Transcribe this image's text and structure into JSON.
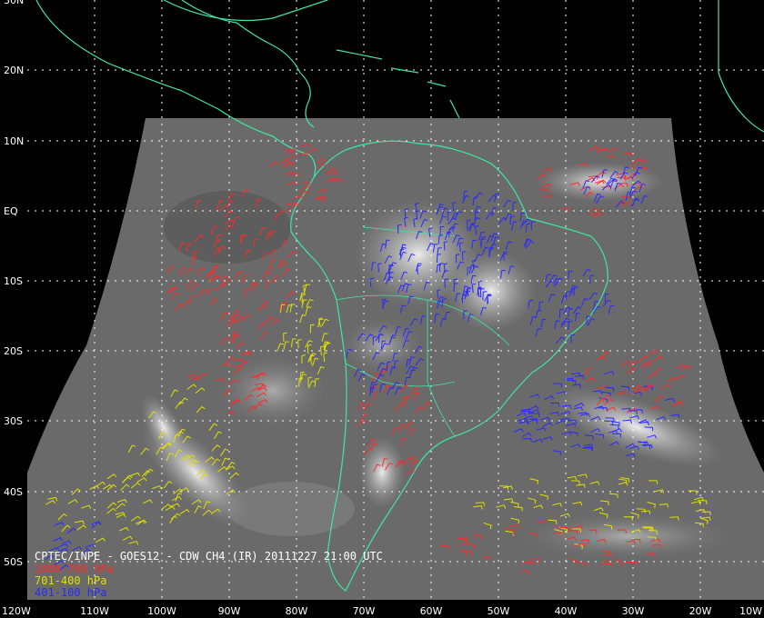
{
  "product_title": "CPTEC/INPE - GOES12 - CDW CH4 (IR) 20111227 21:00 UTC",
  "legend": [
    {
      "label": "1000-700 hPa",
      "color": "#ff2a2a"
    },
    {
      "label": "701-400 hPa",
      "color": "#e0e000"
    },
    {
      "label": "401-100 hPa",
      "color": "#2a2aff"
    }
  ],
  "lat_labels": [
    "30N",
    "20N",
    "10N",
    "EQ",
    "10S",
    "20S",
    "30S",
    "40S",
    "50S"
  ],
  "lon_labels": [
    "120W",
    "110W",
    "100W",
    "90W",
    "80W",
    "70W",
    "60W",
    "50W",
    "40W",
    "30W",
    "20W",
    "10W"
  ],
  "colors": {
    "coastline": "#3ee6a8",
    "grid": "#ffffff",
    "background": "#000000",
    "imagery": "#6e6e6e"
  }
}
